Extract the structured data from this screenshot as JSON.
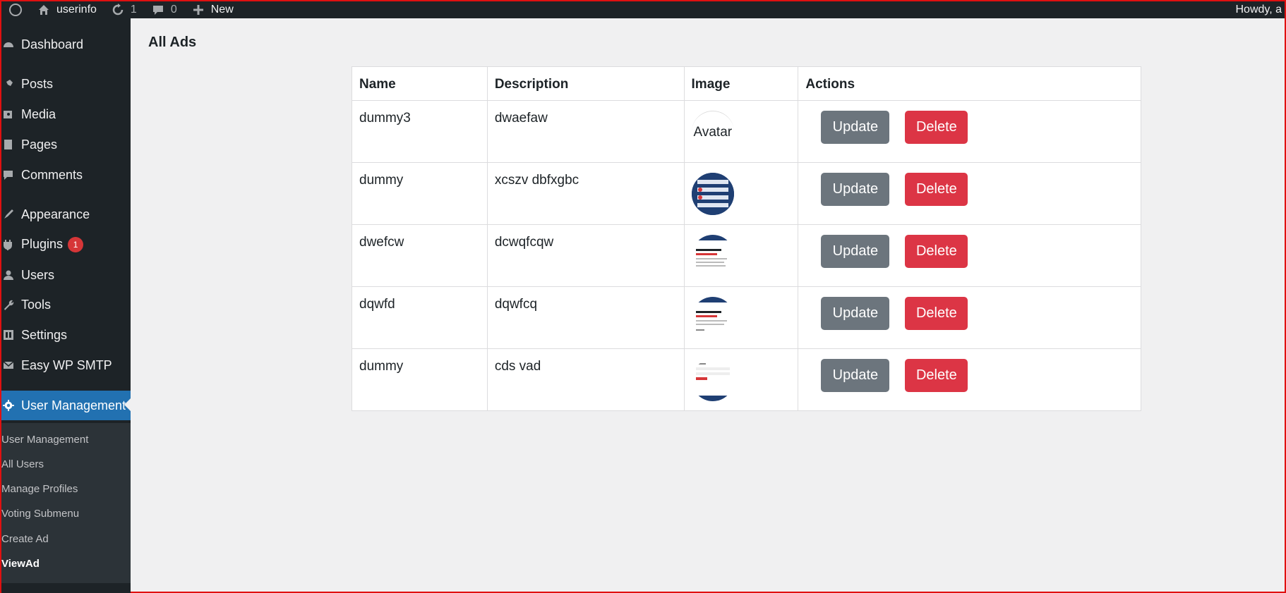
{
  "adminbar": {
    "site_name": "userinfo",
    "updates_count": "1",
    "comments_count": "0",
    "new_label": "New",
    "howdy": "Howdy, a"
  },
  "sidebar": {
    "items": [
      {
        "label": "Dashboard",
        "icon": "dashboard-icon"
      },
      {
        "label": "Posts",
        "icon": "pin-icon"
      },
      {
        "label": "Media",
        "icon": "media-icon"
      },
      {
        "label": "Pages",
        "icon": "page-icon"
      },
      {
        "label": "Comments",
        "icon": "comment-icon"
      },
      {
        "label": "Appearance",
        "icon": "brush-icon"
      },
      {
        "label": "Plugins",
        "icon": "plugin-icon",
        "badge": "1"
      },
      {
        "label": "Users",
        "icon": "user-icon"
      },
      {
        "label": "Tools",
        "icon": "wrench-icon"
      },
      {
        "label": "Settings",
        "icon": "settings-icon"
      },
      {
        "label": "Easy WP SMTP",
        "icon": "mail-icon"
      },
      {
        "label": "User Management",
        "icon": "gear-icon"
      }
    ],
    "submenu": [
      "User Management",
      "All Users",
      "Manage Profiles",
      "Voting Submenu",
      "Create Ad",
      "ViewAd"
    ]
  },
  "main": {
    "title": "All Ads",
    "table": {
      "headers": [
        "Name",
        "Description",
        "Image",
        "Actions"
      ],
      "rows": [
        {
          "name": "dummy3",
          "description": "dwaefaw",
          "image_alt": "Avatar"
        },
        {
          "name": "dummy",
          "description": "xcszv dbfxgbc",
          "image_alt": ""
        },
        {
          "name": "dwefcw",
          "description": "dcwqfcqw",
          "image_alt": ""
        },
        {
          "name": "dqwfd",
          "description": "dqwfcq",
          "image_alt": ""
        },
        {
          "name": "dummy",
          "description": "cds vad",
          "image_alt": ""
        }
      ],
      "update_label": "Update",
      "delete_label": "Delete"
    }
  },
  "colors": {
    "sidebar_bg": "#1d2327",
    "active_blue": "#2271b1",
    "update_btn": "#6c757d",
    "delete_btn": "#dc3545"
  }
}
